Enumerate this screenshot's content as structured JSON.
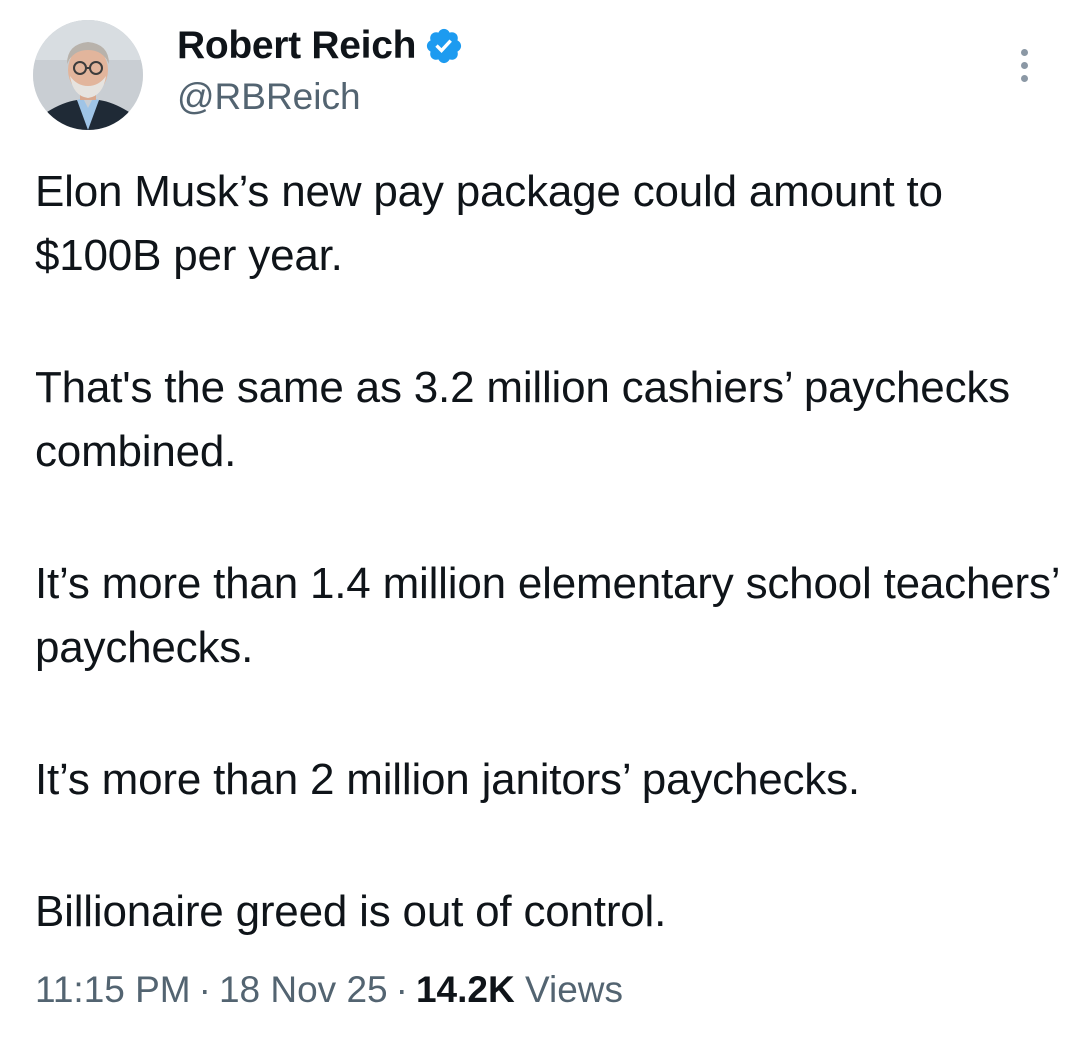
{
  "author": {
    "display_name": "Robert Reich",
    "handle": "@RBReich",
    "verified": true,
    "avatar_icon": "profile-photo"
  },
  "menu": {
    "icon": "more-vertical-icon"
  },
  "tweet": {
    "paragraphs": [
      "Elon Musk’s new pay package could amount to $100B per year.",
      "That's the same as 3.2 million cashiers’ paychecks combined.",
      "It’s more than 1.4 million elementary school teachers’ paychecks.",
      "It’s more than 2 million janitors’ paychecks.",
      "Billionaire greed is out of control."
    ]
  },
  "meta": {
    "time": "11:15 PM",
    "separator": "·",
    "date": "18 Nov 25",
    "views_count": "14.2K",
    "views_label": "Views"
  },
  "colors": {
    "text_primary": "#0f1419",
    "text_secondary": "#536471",
    "verified_blue": "#1d9bf0",
    "background": "#ffffff"
  }
}
